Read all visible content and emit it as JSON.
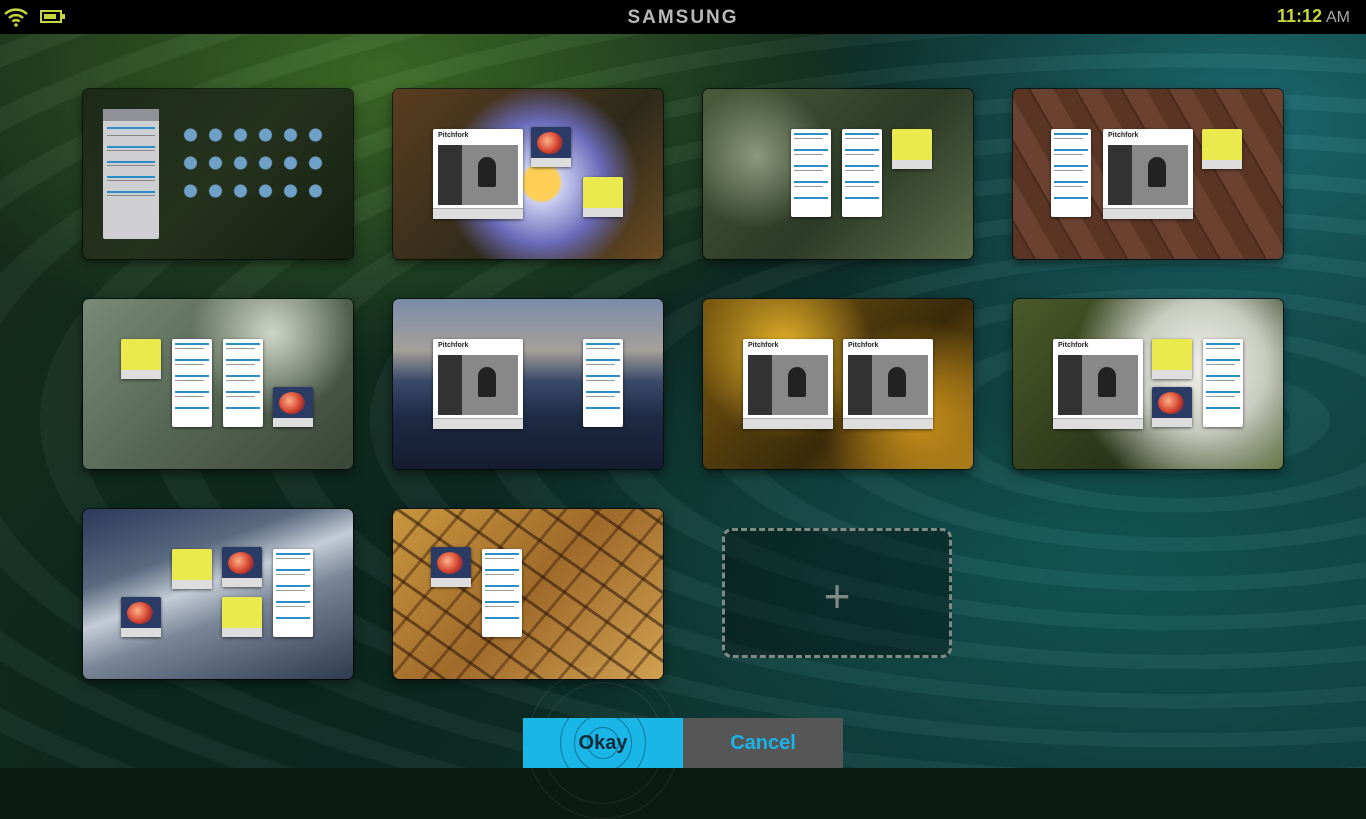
{
  "status_bar": {
    "brand": "SAMSUNG",
    "time": "11:12",
    "ampm": "AM"
  },
  "colors": {
    "accent": "#19b6e6",
    "status_accent": "#c7d63a",
    "cancel_bg": "#565656"
  },
  "screens": [
    {
      "id": 1,
      "background": "dark-green-app-grid",
      "widgets": [
        "contacts-list",
        "app-icons"
      ]
    },
    {
      "id": 2,
      "background": "purple-crocus-flower",
      "widgets": [
        "pitchfork",
        "music",
        "todo"
      ]
    },
    {
      "id": 3,
      "background": "green-dew-grass",
      "widgets": [
        "contacts",
        "contacts",
        "todo"
      ]
    },
    {
      "id": 4,
      "background": "brown-wood-planks",
      "widgets": [
        "contacts",
        "pitchfork",
        "todo"
      ]
    },
    {
      "id": 5,
      "background": "grey-dandelion-seeds",
      "widgets": [
        "todo",
        "contacts",
        "contacts",
        "music"
      ]
    },
    {
      "id": 6,
      "background": "blue-mountain-dusk",
      "widgets": [
        "pitchfork",
        "contacts"
      ]
    },
    {
      "id": 7,
      "background": "yellow-autumn-leaves",
      "widgets": [
        "pitchfork",
        "pitchfork"
      ]
    },
    {
      "id": 8,
      "background": "white-dandelion-puff",
      "widgets": [
        "pitchfork",
        "todo",
        "music",
        "contacts"
      ]
    },
    {
      "id": 9,
      "background": "slate-architecture",
      "widgets": [
        "music",
        "todo",
        "music",
        "todo",
        "contacts"
      ]
    },
    {
      "id": 10,
      "background": "stacked-firewood",
      "widgets": [
        "music",
        "contacts"
      ]
    }
  ],
  "add_screen": {
    "icon": "plus-icon",
    "label": "+"
  },
  "actions": {
    "okay": "Okay",
    "cancel": "Cancel"
  }
}
